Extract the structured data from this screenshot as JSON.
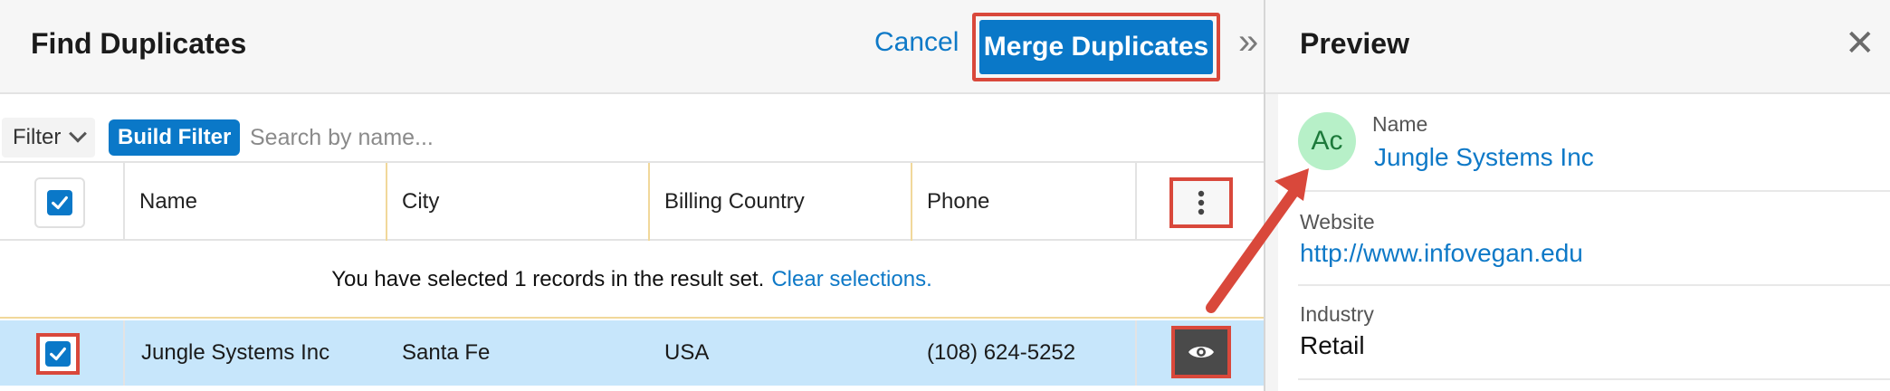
{
  "left_panel": {
    "title": "Find Duplicates",
    "cancel_label": "Cancel",
    "merge_label": "Merge Duplicates",
    "collapse_icon": "double-chevron-right-icon",
    "filter": {
      "filter_label": "Filter",
      "build_filter_label": "Build Filter",
      "search_placeholder": "Search by name..."
    },
    "columns": [
      "Name",
      "City",
      "Billing Country",
      "Phone"
    ],
    "selection_notice": {
      "text": "You have selected 1 records in the result set.",
      "link": "Clear selections."
    },
    "rows": [
      {
        "name": "Jungle Systems Inc",
        "city": "Santa Fe",
        "billing_country": "USA",
        "phone": "(108) 624-5252",
        "selected": true
      }
    ]
  },
  "preview_panel": {
    "title": "Preview",
    "close_icon": "close-icon",
    "avatar_initials": "Ac",
    "fields": {
      "name_label": "Name",
      "name_value": "Jungle Systems Inc",
      "website_label": "Website",
      "website_value": "http://www.infovegan.edu",
      "industry_label": "Industry",
      "industry_value": "Retail"
    }
  },
  "colors": {
    "accent_blue": "#0a78c8",
    "link_blue": "#0e79c7",
    "highlight_red": "#d9483b",
    "selected_row": "#c7e6fb",
    "avatar_green": "#b7f0c8"
  }
}
